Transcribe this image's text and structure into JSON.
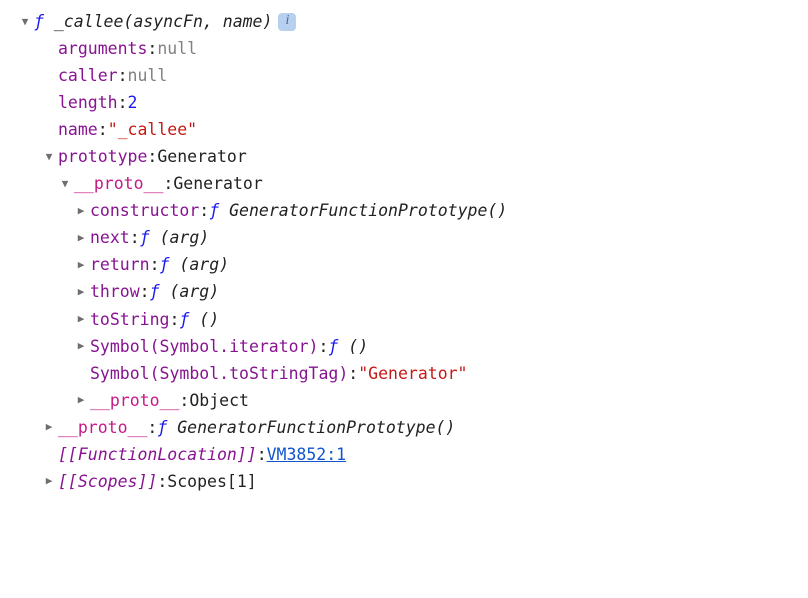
{
  "header": {
    "fn_keyword": "ƒ",
    "fn_name": "_callee",
    "fn_params": "(asyncFn, name)"
  },
  "level1": {
    "arguments": {
      "key": "arguments",
      "value": "null"
    },
    "caller": {
      "key": "caller",
      "value": "null"
    },
    "length": {
      "key": "length",
      "value": "2"
    },
    "name": {
      "key": "name",
      "value": "\"_callee\""
    },
    "prototype": {
      "key": "prototype",
      "value": "Generator"
    },
    "proto": {
      "key": "__proto__",
      "fn": "GeneratorFunctionPrototype()"
    },
    "funcLoc": {
      "key": "[[FunctionLocation]]",
      "link": "VM3852:1"
    },
    "scopes": {
      "key": "[[Scopes]]",
      "value": "Scopes[1]"
    }
  },
  "level2": {
    "proto": {
      "key": "__proto__",
      "value": "Generator"
    }
  },
  "level3": {
    "constructor": {
      "key": "constructor",
      "fn": "GeneratorFunctionPrototype()"
    },
    "next": {
      "key": "next",
      "fn": "(arg)"
    },
    "return": {
      "key": "return",
      "fn": "(arg)"
    },
    "throw": {
      "key": "throw",
      "fn": "(arg)"
    },
    "toString": {
      "key": "toString",
      "fn": "()"
    },
    "symIterator": {
      "key": "Symbol(Symbol.iterator)",
      "fn": "()"
    },
    "symStrTag": {
      "key": "Symbol(Symbol.toStringTag)",
      "value": "\"Generator\""
    },
    "proto": {
      "key": "__proto__",
      "value": "Object"
    }
  }
}
